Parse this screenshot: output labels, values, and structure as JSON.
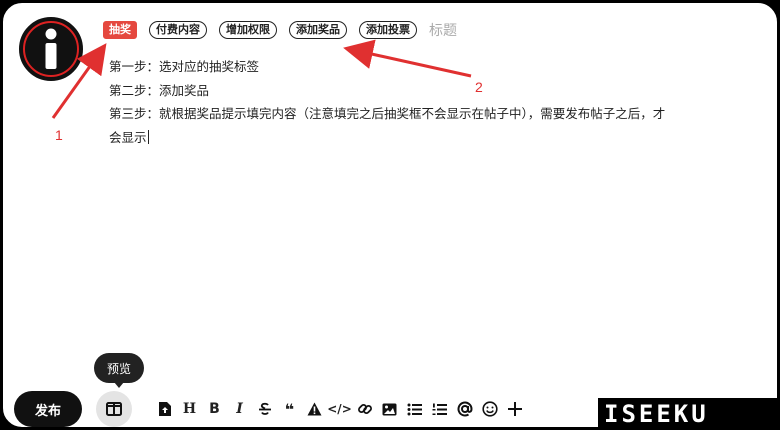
{
  "tags": [
    {
      "label": "抽奖",
      "active": true
    },
    {
      "label": "付费内容",
      "active": false
    },
    {
      "label": "增加权限",
      "active": false
    },
    {
      "label": "添加奖品",
      "active": false
    },
    {
      "label": "添加投票",
      "active": false
    }
  ],
  "title_placeholder": "标题",
  "content": {
    "line1": "第一步：选对应的抽奖标签",
    "line2": "第二步：添加奖品",
    "line3": "第三步：就根据奖品提示填完内容（注意填完之后抽奖框不会显示在帖子中），需要发布帖子之后，才",
    "line4": "会显示"
  },
  "annotations": {
    "label1": "1",
    "label2": "2",
    "color": "#e03030"
  },
  "tooltip": "预览",
  "toolbar": {
    "publish_label": "发布",
    "heading_label": "H",
    "bold_label": "B",
    "italic_label": "I",
    "quote_label": "❝",
    "code_label": "</>"
  },
  "watermark": "ISEEKU",
  "colors": {
    "accent": "#e5483f",
    "dark": "#111111"
  }
}
